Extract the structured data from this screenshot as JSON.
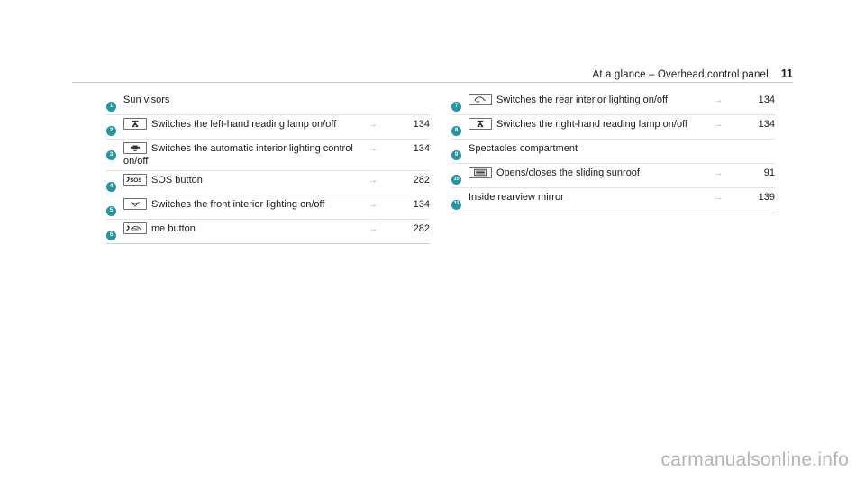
{
  "header": {
    "title": "At a glance – Overhead control panel",
    "page_number": "11"
  },
  "arrow_glyph": "→",
  "colors": {
    "badge": "#1e97a6",
    "rule": "#e3e3e3",
    "text": "#1a1a1a",
    "arrow": "#a8a8a8",
    "watermark": "#b5b5b5"
  },
  "left_column": [
    {
      "badge": "1",
      "icon": "none",
      "label": "Sun visors",
      "arrow": "",
      "page": ""
    },
    {
      "badge": "2",
      "icon": "reading-lamp-icon",
      "label": "Switches the left-hand reading lamp on/off",
      "arrow": "→",
      "page": "134"
    },
    {
      "badge": "3",
      "icon": "automatic-interior-lighting-icon",
      "label": "Switches the automatic interior lighting control on/off",
      "arrow": "→",
      "page": "134"
    },
    {
      "badge": "4",
      "icon": "sos-icon",
      "label": "SOS button",
      "arrow": "→",
      "page": "282"
    },
    {
      "badge": "5",
      "icon": "front-interior-lighting-icon",
      "label": "Switches the front interior lighting on/off",
      "arrow": "→",
      "page": "134"
    },
    {
      "badge": "6",
      "icon": "me-button-icon",
      "label": "me button",
      "arrow": "→",
      "page": "282"
    }
  ],
  "right_column": [
    {
      "badge": "7",
      "icon": "rear-interior-lighting-icon",
      "label": "Switches the rear interior lighting on/off",
      "arrow": "→",
      "page": "134"
    },
    {
      "badge": "8",
      "icon": "reading-lamp-icon",
      "label": "Switches the right-hand reading lamp on/off",
      "arrow": "→",
      "page": "134"
    },
    {
      "badge": "9",
      "icon": "none",
      "label": "Spectacles compartment",
      "arrow": "",
      "page": ""
    },
    {
      "badge": "10",
      "icon": "sliding-sunroof-icon",
      "label": "Opens/closes the sliding sunroof",
      "arrow": "→",
      "page": "91"
    },
    {
      "badge": "11",
      "icon": "none",
      "label": "Inside rearview mirror",
      "arrow": "→",
      "page": "139"
    }
  ],
  "watermark": "carmanualsonline.info"
}
